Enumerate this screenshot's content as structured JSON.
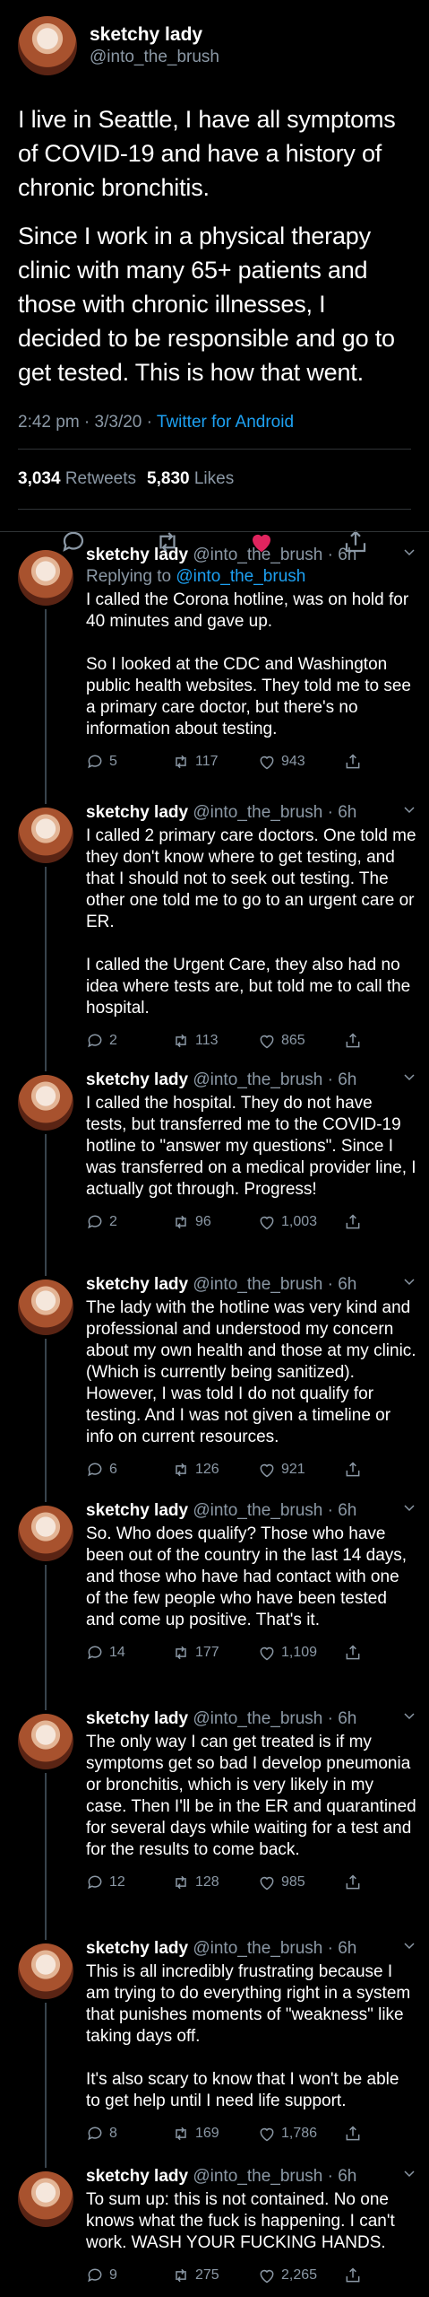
{
  "tweet": {
    "display_name": "sketchy lady",
    "handle": "@into_the_brush",
    "paragraphs": [
      "I live in Seattle, I have all symptoms of COVID-19 and have a history of chronic bronchitis.",
      "Since I work in a physical therapy clinic with many 65+ patients and those with chronic illnesses, I decided to be responsible and go to get tested. This is how that went."
    ],
    "time": "2:42 pm · 3/3/20 · ",
    "client": "Twitter for Android",
    "retweets": "3,034",
    "retweets_label": "Retweets",
    "likes": "5,830",
    "likes_label": "Likes"
  },
  "colors": {
    "like_active": "#e0245e",
    "link": "#1da1f2",
    "muted": "#8b98a5"
  },
  "replies": [
    {
      "name": "sketchy lady",
      "meta": "@into_the_brush · 6h",
      "replying_prefix": "Replying to ",
      "replying_to": "@into_the_brush",
      "paragraphs": [
        "I called the Corona hotline, was on hold for 40 minutes and gave up.",
        "So I looked at the CDC and Washington public health websites.  They told me to see a primary care doctor, but there's no information about testing."
      ],
      "replies": "5",
      "retweets": "117",
      "likes": "943"
    },
    {
      "name": "sketchy lady",
      "meta": "@into_the_brush · 6h",
      "paragraphs": [
        "I called 2 primary care doctors. One told me they don't know where to get testing, and that I should not to seek out testing. The other one told me to go to an urgent care or ER.",
        "I called the Urgent Care, they also had no idea where tests are, but told me to call the hospital."
      ],
      "replies": "2",
      "retweets": "113",
      "likes": "865"
    },
    {
      "name": "sketchy lady",
      "meta": "@into_the_brush · 6h",
      "paragraphs": [
        "I called the hospital. They do not have tests, but transferred me to the COVID-19 hotline to \"answer my questions\". Since I was transferred on a medical provider line, I actually got through. Progress!"
      ],
      "replies": "2",
      "retweets": "96",
      "likes": "1,003"
    },
    {
      "name": "sketchy lady",
      "meta": "@into_the_brush · 6h",
      "paragraphs": [
        "The lady with the hotline was very kind and professional and understood my concern about my own health and those at my clinic. (Which is currently being sanitized). However, I was told I do not qualify for testing. And I was not given a timeline or info on current resources."
      ],
      "replies": "6",
      "retweets": "126",
      "likes": "921"
    },
    {
      "name": "sketchy lady",
      "meta": "@into_the_brush · 6h",
      "paragraphs": [
        "So. Who does qualify? Those who have been out of the country in the last 14 days, and those who have had contact with one of the few people who have been tested and come up positive. That's it."
      ],
      "replies": "14",
      "retweets": "177",
      "likes": "1,109"
    },
    {
      "name": "sketchy lady",
      "meta": "@into_the_brush · 6h",
      "paragraphs": [
        "The only way I can get treated is if my symptoms get so bad I develop pneumonia or bronchitis, which is very likely in my case. Then I'll be in the ER and quarantined for several days while waiting for a test and for the results to come back."
      ],
      "replies": "12",
      "retweets": "128",
      "likes": "985"
    },
    {
      "name": "sketchy lady",
      "meta": "@into_the_brush · 6h",
      "paragraphs": [
        "This is all incredibly frustrating because I am trying to do everything right in a system that punishes moments of \"weakness\" like taking days off.",
        "It's also scary to know that I won't be able to get help until I need life support."
      ],
      "replies": "8",
      "retweets": "169",
      "likes": "1,786"
    },
    {
      "name": "sketchy lady",
      "meta": "@into_the_brush · 6h",
      "paragraphs": [
        "To sum up: this is not contained. No one knows what the fuck is happening. I can't work. WASH YOUR FUCKING HANDS."
      ],
      "replies": "9",
      "retweets": "275",
      "likes": "2,265"
    }
  ]
}
